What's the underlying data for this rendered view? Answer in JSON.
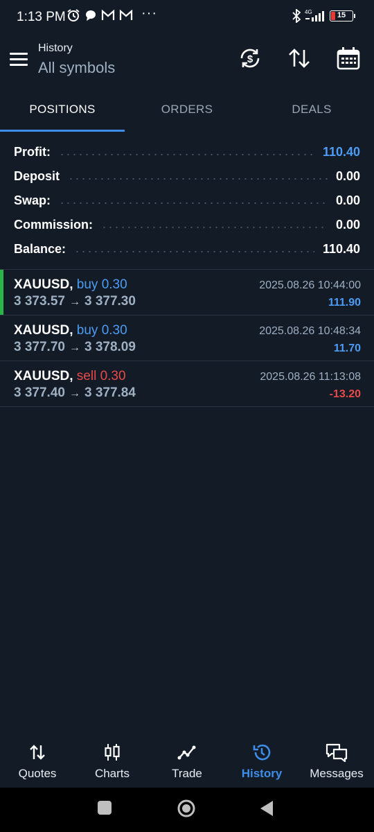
{
  "status": {
    "time": "1:13 PM",
    "network": "4G",
    "battery": "15",
    "more": "···"
  },
  "header": {
    "title": "History",
    "subtitle": "All symbols"
  },
  "tabs": [
    {
      "label": "POSITIONS",
      "active": true
    },
    {
      "label": "ORDERS",
      "active": false
    },
    {
      "label": "DEALS",
      "active": false
    }
  ],
  "summary": [
    {
      "label": "Profit:",
      "value": "110.40"
    },
    {
      "label": "Deposit",
      "value": "0.00"
    },
    {
      "label": "Swap:",
      "value": "0.00"
    },
    {
      "label": "Commission:",
      "value": "0.00"
    },
    {
      "label": "Balance:",
      "value": "110.40"
    }
  ],
  "positions": [
    {
      "symbol": "XAUUSD,",
      "side": "buy 0.30",
      "open": "3 373.57",
      "arrow": "→",
      "close": "3 377.30",
      "time": "2025.08.26 10:44:00",
      "profit": "111.90"
    },
    {
      "symbol": "XAUUSD,",
      "side": "buy 0.30",
      "open": "3 377.70",
      "arrow": "→",
      "close": "3 378.09",
      "time": "2025.08.26 10:48:34",
      "profit": "11.70"
    },
    {
      "symbol": "XAUUSD,",
      "side": "sell 0.30",
      "open": "3 377.40",
      "arrow": "→",
      "close": "3 377.84",
      "time": "2025.08.26 11:13:08",
      "profit": "-13.20"
    }
  ],
  "nav": [
    {
      "label": "Quotes",
      "icon": "quotes-icon"
    },
    {
      "label": "Charts",
      "icon": "charts-icon"
    },
    {
      "label": "Trade",
      "icon": "trade-icon"
    },
    {
      "label": "History",
      "icon": "history-icon",
      "active": true
    },
    {
      "label": "Messages",
      "icon": "messages-icon"
    }
  ],
  "colors": {
    "background": "#131b26",
    "accent": "#3d8eea",
    "profit_positive": "#4d9cf5",
    "profit_negative": "#e84a4a",
    "highlight_bar": "#2bb44a"
  }
}
